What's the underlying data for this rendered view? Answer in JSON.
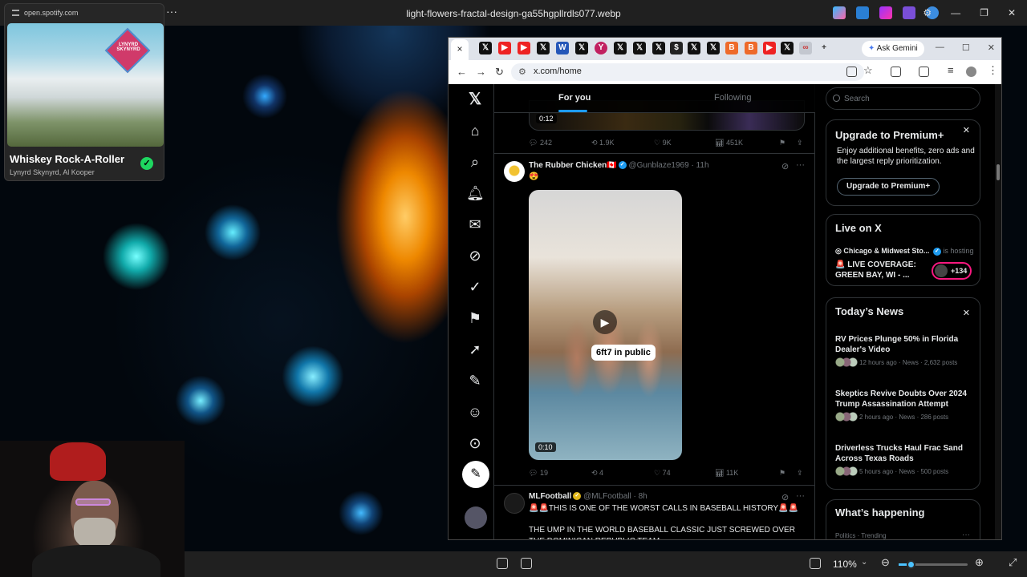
{
  "viewer": {
    "file_name": "light-flowers-fractal-design-ga55hgpllrdls077.webp",
    "zoom": "110%",
    "more_label": "···"
  },
  "spotify": {
    "url": "open.spotify.com",
    "track_title": "Whiskey Rock-A-Roller",
    "artists": "Lynyrd Skynyrd, Al Kooper",
    "album_logo_text": "LYNYRD SKYNYRD"
  },
  "browser": {
    "address": "x.com/home",
    "ask_gemini": "Ask Gemini",
    "close_tab": "×",
    "new_tab": "+"
  },
  "x": {
    "tabs": {
      "for_you": "For you",
      "following": "Following"
    },
    "search_placeholder": "Search",
    "prev_post": {
      "duration": "0:12",
      "replies": "242",
      "reposts": "1.9K",
      "likes": "9K",
      "views": "451K"
    },
    "post1": {
      "author": "The Rubber Chicken🇨🇦",
      "handle": "@Gunblaze1969 · 11h",
      "text": "😍",
      "video_caption": "6ft7 in public",
      "duration": "0:10",
      "replies": "19",
      "reposts": "4",
      "likes": "74",
      "views": "11K"
    },
    "post2": {
      "author": "MLFootball",
      "handle": "@MLFootball · 8h",
      "text1": "🚨🚨THIS IS ONE OF THE WORST CALLS IN BASEBALL HISTORY🚨🚨",
      "text2": "THE UMP IN THE WORLD BASEBALL CLASSIC JUST SCREWED OVER THE DOMINICAN REPUBLIC TEAM"
    },
    "premium": {
      "title": "Upgrade to Premium+",
      "body": "Enjoy additional benefits, zero ads and the largest reply prioritization.",
      "button": "Upgrade to Premium+"
    },
    "live": {
      "title": "Live on X",
      "host": "Chicago & Midwest Sto...",
      "hosting": "is hosting",
      "event": "🚨 LIVE COVERAGE: GREEN BAY, WI - ...",
      "count": "+134"
    },
    "news": {
      "title": "Today’s News",
      "items": [
        {
          "headline": "RV Prices Plunge 50% in Florida Dealer's Video",
          "meta": "12 hours ago · News · 2,632 posts"
        },
        {
          "headline": "Skeptics Revive Doubts Over 2024 Trump Assassination Attempt",
          "meta": "2 hours ago · News · 286 posts"
        },
        {
          "headline": "Driverless Trucks Haul Frac Sand Across Texas Roads",
          "meta": "5 hours ago · News · 500 posts"
        }
      ]
    },
    "happening": {
      "title": "What’s happening",
      "meta": "Politics · Trending",
      "more": "···"
    }
  }
}
